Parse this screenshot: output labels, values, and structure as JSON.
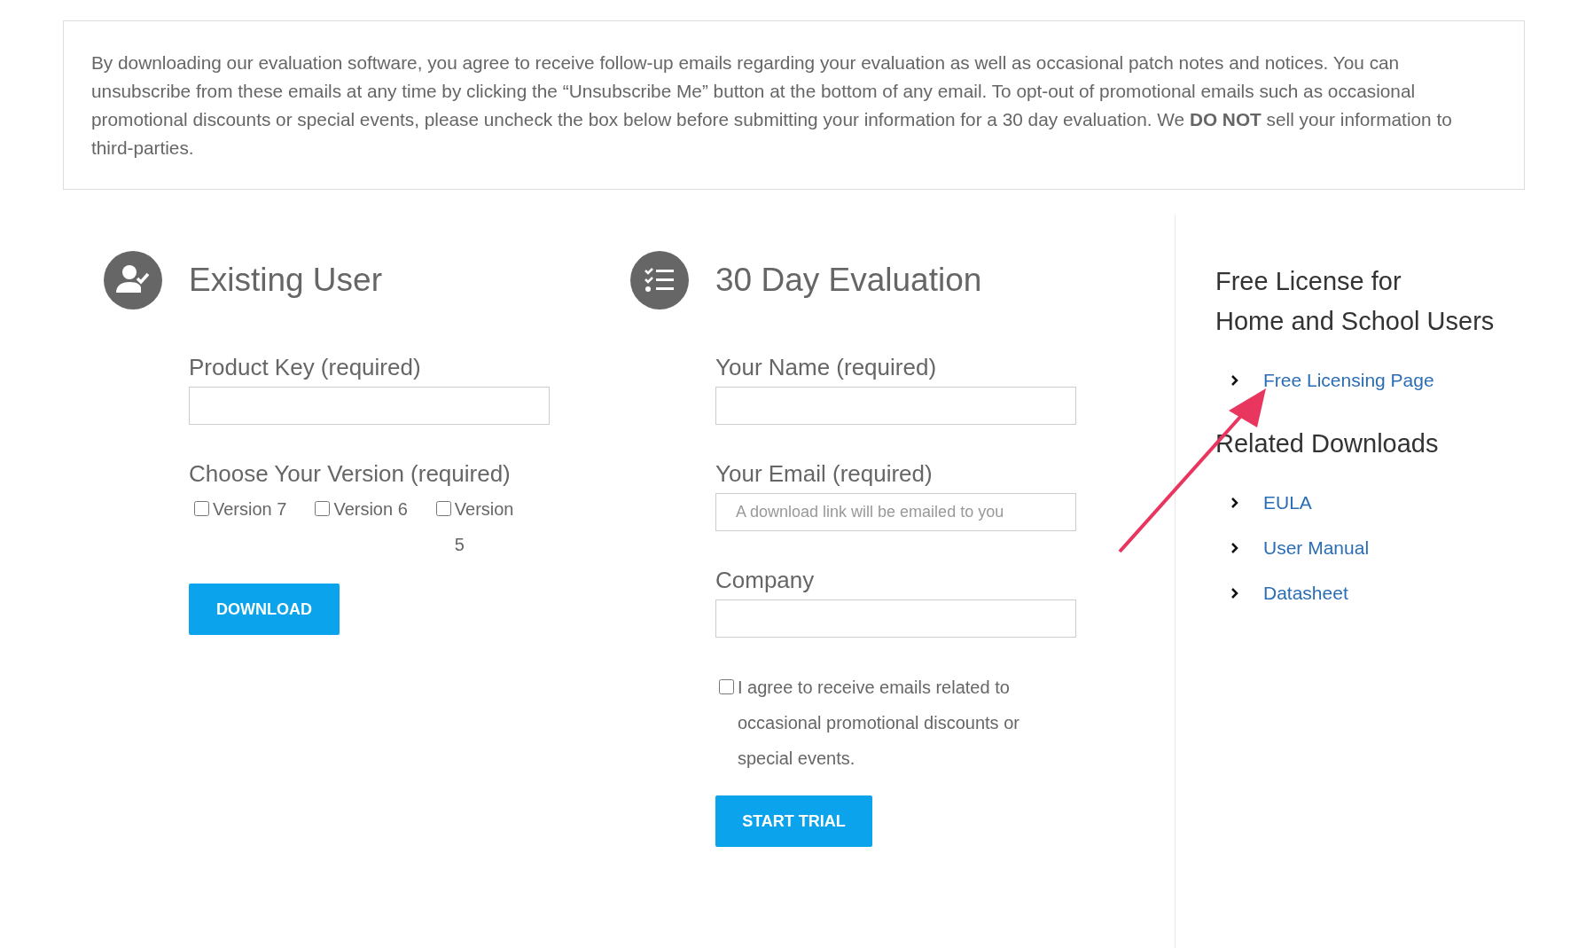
{
  "notice": {
    "text": "By downloading our evaluation software, you agree to receive follow-up emails regarding your evaluation as well as occasional patch notes and notices. You can unsubscribe from these emails at any time by clicking the “Unsubscribe Me” button at the bottom of any email. To opt-out of promotional emails such as occasional promotional discounts or special events, please uncheck the box below before submitting your information for a 30 day evaluation. We **DO NOT** sell your information to third-parties."
  },
  "existing_user": {
    "title": "Existing User",
    "product_key": {
      "label": "Product Key (required)"
    },
    "version": {
      "label": "Choose Your Version (required)",
      "options": [
        {
          "label": "Version 7",
          "checked": false
        },
        {
          "label": "Version 6",
          "checked": false
        },
        {
          "label": "Version 5",
          "checked": false
        }
      ]
    },
    "button": "DOWNLOAD"
  },
  "evaluation": {
    "title": "30 Day Evaluation",
    "fields": [
      {
        "label": "Your Name (required)"
      },
      {
        "label": "Your Email (required)",
        "placeholder": "A download link will be emailed to you"
      },
      {
        "label": "Company"
      }
    ],
    "agree": {
      "label": "I agree to receive emails related to occasional promotional discounts or special events.",
      "checked": false
    },
    "button": "START TRIAL"
  },
  "sidebar": {
    "sections": [
      {
        "title": "Free License for\nHome and School Users",
        "links": [
          "Free Licensing Page"
        ]
      },
      {
        "title": "Related Downloads",
        "links": [
          "EULA",
          "User Manual",
          "Datasheet"
        ]
      }
    ]
  },
  "annotation": {
    "kind": "arrow"
  }
}
